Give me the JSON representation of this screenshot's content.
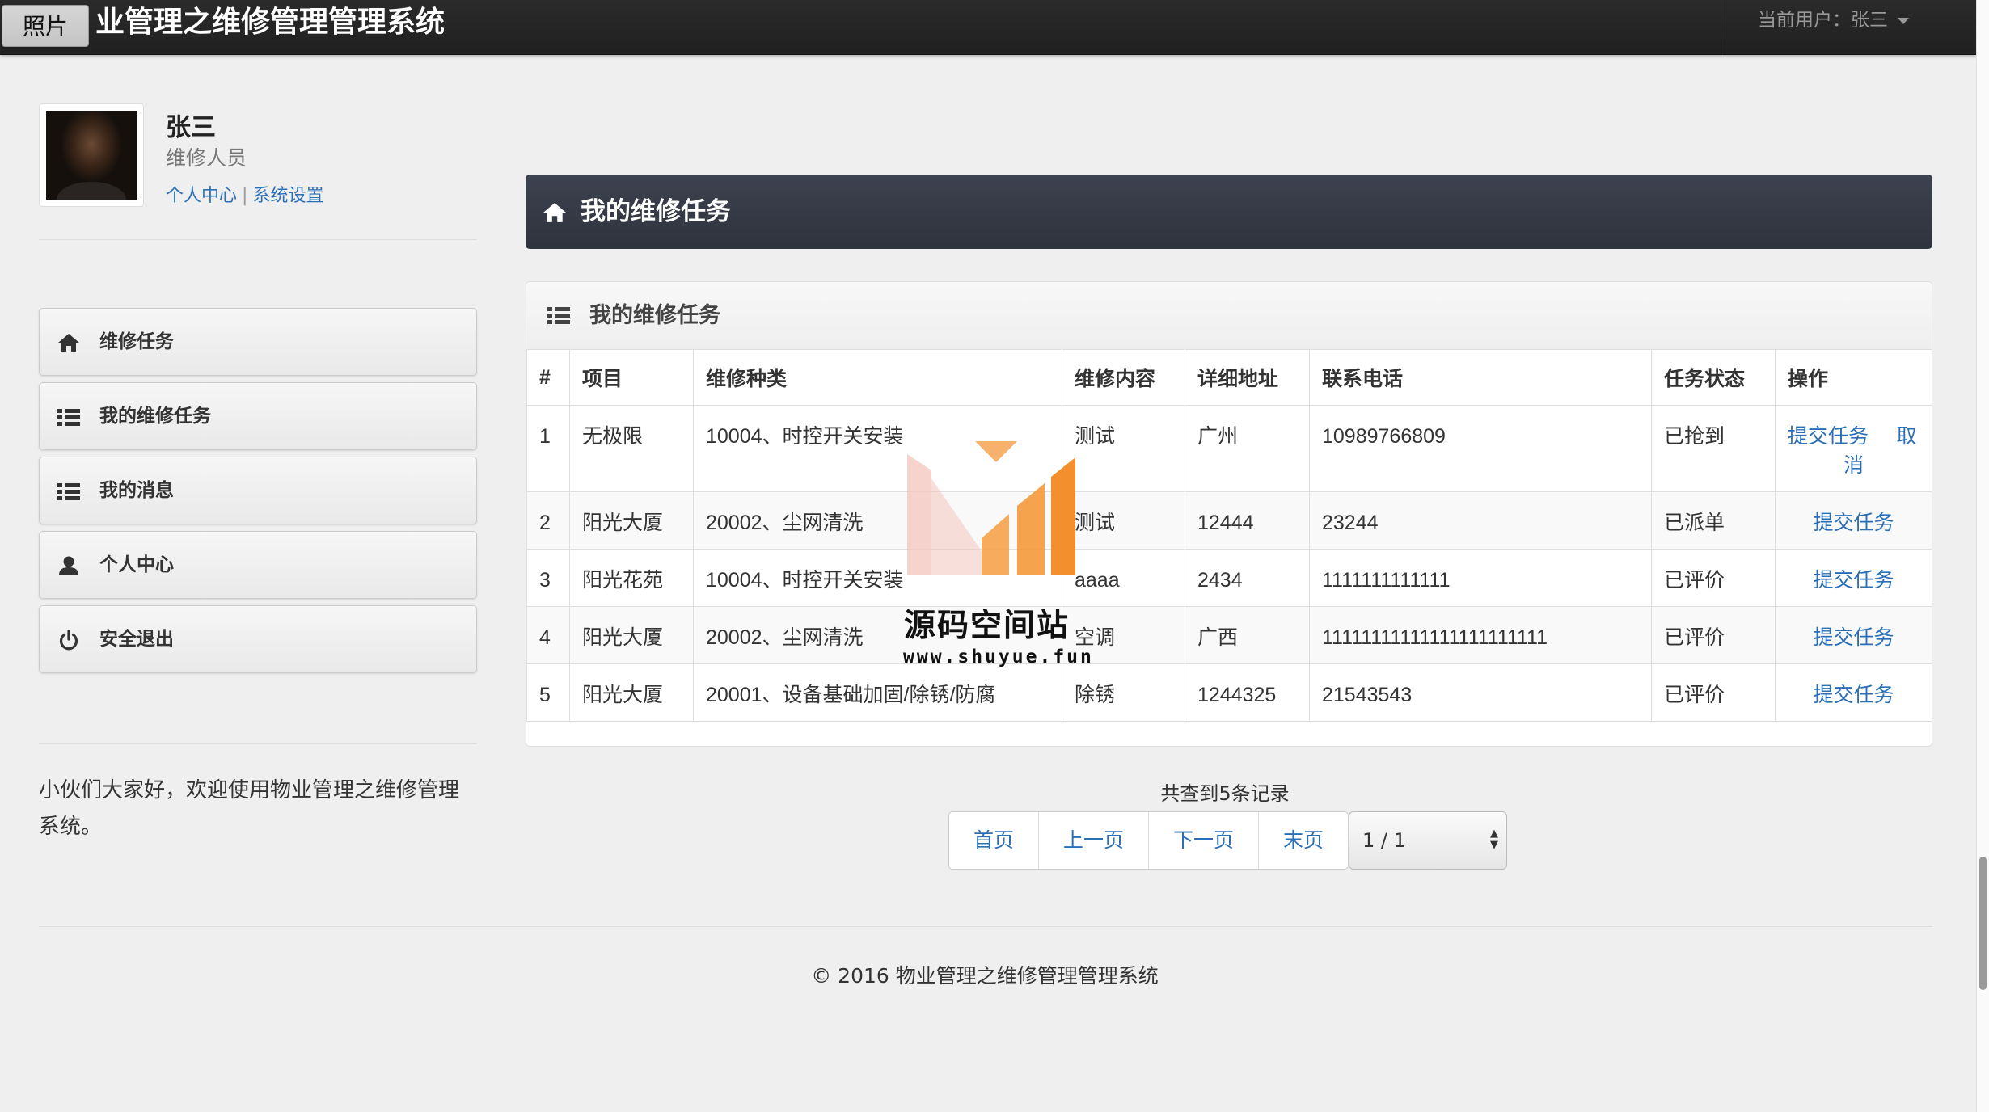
{
  "navbar": {
    "photo_label": "照片",
    "brand": "业管理之维修管理管理系统",
    "user_menu": "当前用户：张三"
  },
  "profile": {
    "name": "张三",
    "role": "维修人员",
    "link_personal": "个人中心",
    "link_sep": "|",
    "link_settings": "系统设置"
  },
  "sidebar": {
    "items": [
      {
        "label": "维修任务",
        "icon": "home-icon"
      },
      {
        "label": "我的维修任务",
        "icon": "list-icon"
      },
      {
        "label": "我的消息",
        "icon": "list-icon"
      },
      {
        "label": "个人中心",
        "icon": "user-icon"
      },
      {
        "label": "安全退出",
        "icon": "power-icon"
      }
    ],
    "welcome": "小伙们大家好，欢迎使用物业管理之维修管理系统。"
  },
  "main": {
    "page_title": "我的维修任务",
    "panel_title": "我的维修任务",
    "columns": [
      "#",
      "项目",
      "维修种类",
      "维修内容",
      "详细地址",
      "联系电话",
      "任务状态",
      "操作"
    ],
    "rows": [
      {
        "no": "1",
        "project": "无极限",
        "type": "10004、时控开关安装",
        "content": "测试",
        "address": "广州",
        "phone": "10989766809",
        "status": "已抢到",
        "op_submit": "提交任务",
        "op_cancel": "取消"
      },
      {
        "no": "2",
        "project": "阳光大厦",
        "type": "20002、尘网清洗",
        "content": "测试",
        "address": "12444",
        "phone": "23244",
        "status": "已派单",
        "op_submit": "提交任务"
      },
      {
        "no": "3",
        "project": "阳光花苑",
        "type": "10004、时控开关安装",
        "content": "aaaa",
        "address": "2434",
        "phone": "1111111111111",
        "status": "已评价",
        "op_submit": "提交任务"
      },
      {
        "no": "4",
        "project": "阳光大厦",
        "type": "20002、尘网清洗",
        "content": "空调",
        "address": "广西",
        "phone": "11111111111111111111111",
        "status": "已评价",
        "op_submit": "提交任务"
      },
      {
        "no": "5",
        "project": "阳光大厦",
        "type": "20001、设备基础加固/除锈/防腐",
        "content": "除锈",
        "address": "1244325",
        "phone": "21543543",
        "status": "已评价",
        "op_submit": "提交任务"
      }
    ]
  },
  "pagination": {
    "records_text": "共查到5条记录",
    "first": "首页",
    "prev": "上一页",
    "next": "下一页",
    "last": "末页",
    "page_select_value": "1 / 1"
  },
  "footer": {
    "copyright": "© 2016 物业管理之维修管理管理系统"
  },
  "watermark": {
    "title": "源码空间站",
    "url": "www.shuyue.fun"
  }
}
